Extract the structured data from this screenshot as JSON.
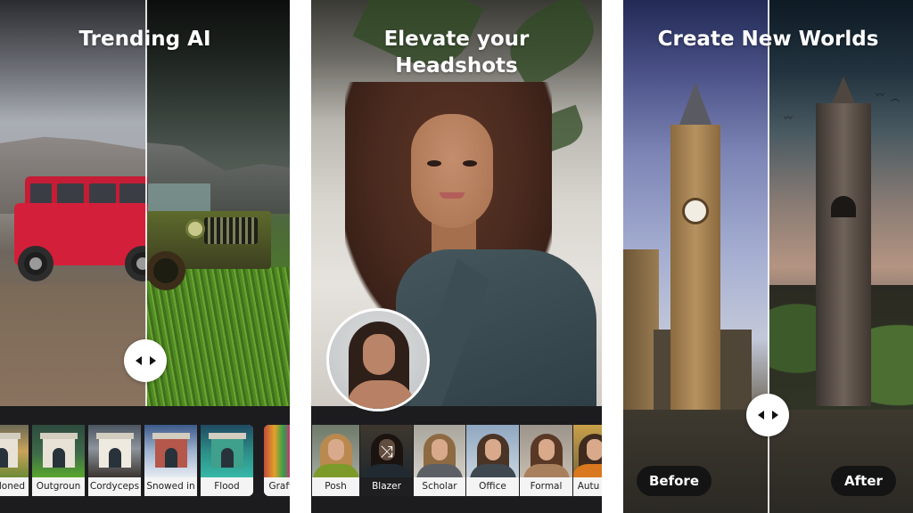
{
  "panels": [
    {
      "id": "trending-ai",
      "title": "Trending AI",
      "style_tiles": [
        {
          "label": "Abandoned",
          "visible_label": "ndoned"
        },
        {
          "label": "Outgroun"
        },
        {
          "label": "Cordyceps"
        },
        {
          "label": "Snowed in"
        },
        {
          "label": "Flood"
        },
        {
          "label": "Graffi"
        }
      ],
      "comparison_split": 0.5
    },
    {
      "id": "headshots",
      "title_line1": "Elevate your",
      "title_line2": "Headshots",
      "style_tiles": [
        {
          "label": "Posh"
        },
        {
          "label": "Blazer",
          "selected": true,
          "icon": "shuffle-icon"
        },
        {
          "label": "Scholar"
        },
        {
          "label": "Office"
        },
        {
          "label": "Formal"
        },
        {
          "label": "Autu"
        }
      ]
    },
    {
      "id": "new-worlds",
      "title": "Create New Worlds",
      "before_label": "Before",
      "after_label": "After",
      "comparison_split": 0.5
    }
  ],
  "icons": {
    "slider_handle": "left-right-arrows-icon",
    "shuffle": "⤨"
  },
  "colors": {
    "bar_background": "#1c1c1f",
    "tile_label_bg": "#f4f4f4",
    "tile_selected_bg": "#1f1f22",
    "pill_bg": "#141414",
    "text_light": "#ffffff"
  }
}
